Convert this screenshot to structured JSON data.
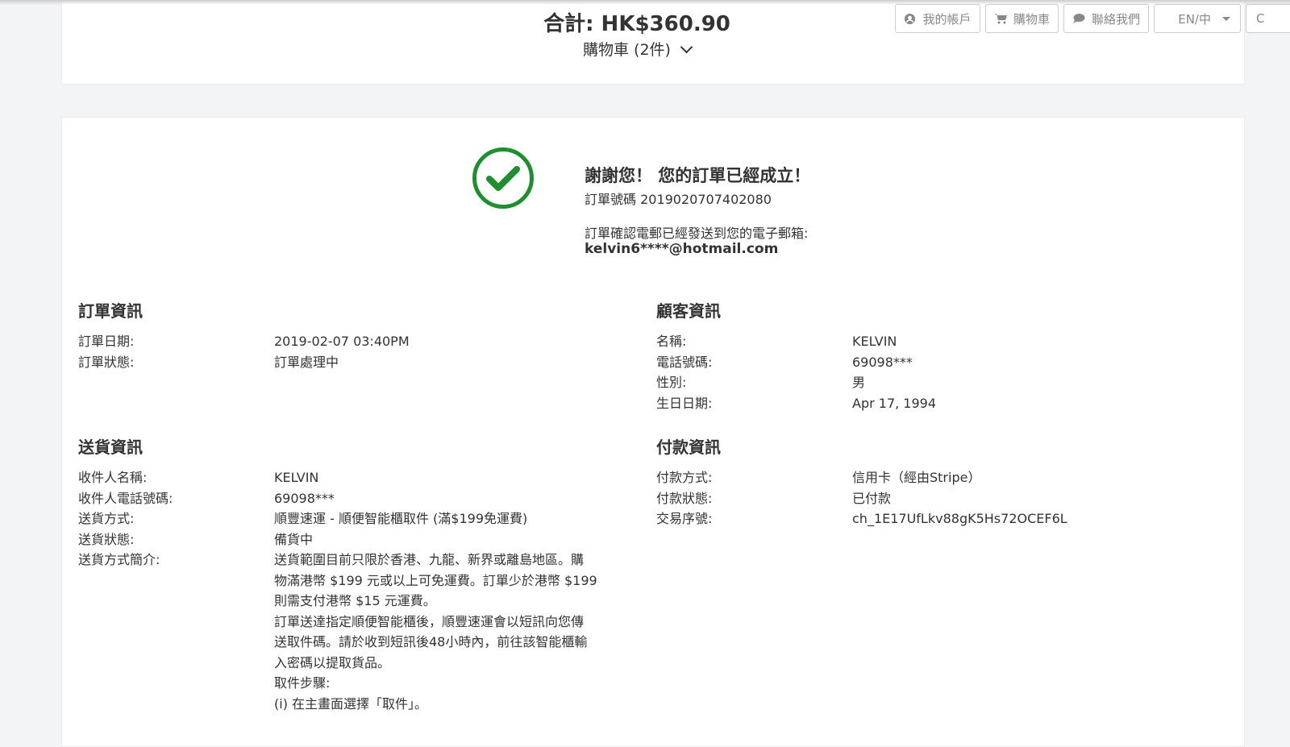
{
  "header": {
    "total": "合計: HK$360.90",
    "cart_summary": "購物車 (2件)",
    "nav": {
      "account": "我的帳戶",
      "cart": "購物車",
      "contact": "聯絡我們",
      "language": "EN/中",
      "partial": "C"
    }
  },
  "confirmation": {
    "title": "謝謝您！ 您的訂單已經成立！",
    "order_number": "訂單號碼 2019020707402080",
    "email_note": "訂單確認電郵已經發送到您的電子郵箱:",
    "email": "kelvin6****@hotmail.com",
    "check_color": "#1e8e2e"
  },
  "order_info": {
    "title": "訂單資訊",
    "rows": [
      {
        "label": "訂單日期:",
        "value": "2019-02-07 03:40PM"
      },
      {
        "label": "訂單狀態:",
        "value": "訂單處理中"
      }
    ]
  },
  "customer_info": {
    "title": "顧客資訊",
    "rows": [
      {
        "label": "名稱:",
        "value": "KELVIN"
      },
      {
        "label": "電話號碼:",
        "value": "69098***"
      },
      {
        "label": "性別:",
        "value": "男"
      },
      {
        "label": "生日日期:",
        "value": "Apr 17, 1994"
      }
    ]
  },
  "delivery_info": {
    "title": "送貨資訊",
    "rows": [
      {
        "label": "收件人名稱:",
        "value": "KELVIN"
      },
      {
        "label": "收件人電話號碼:",
        "value": "69098***"
      },
      {
        "label": "送貨方式:",
        "value": "順豐速運 - 順便智能櫃取件 (滿$199免運費)"
      },
      {
        "label": "送貨狀態:",
        "value": "備貨中"
      }
    ],
    "description_label": "送貨方式簡介:",
    "description_lines": [
      "送貨範圍目前只限於香港、九龍、新界或離島地區。購",
      "物滿港幣 $199 元或以上可免運費。訂單少於港幣 $199",
      "則需支付港幣 $15 元運費。",
      "訂單送達指定順便智能櫃後，順豐速運會以短訊向您傳",
      "送取件碼。請於收到短訊後48小時內，前往該智能櫃輸",
      "入密碼以提取貨品。",
      "取件步驟:",
      "(i) 在主畫面選擇「取件」。"
    ]
  },
  "payment_info": {
    "title": "付款資訊",
    "rows": [
      {
        "label": "付款方式:",
        "value": "信用卡（經由Stripe）"
      },
      {
        "label": "付款狀態:",
        "value": "已付款"
      },
      {
        "label": "交易序號:",
        "value": "ch_1E17UfLkv88gK5Hs72OCEF6L"
      }
    ]
  }
}
